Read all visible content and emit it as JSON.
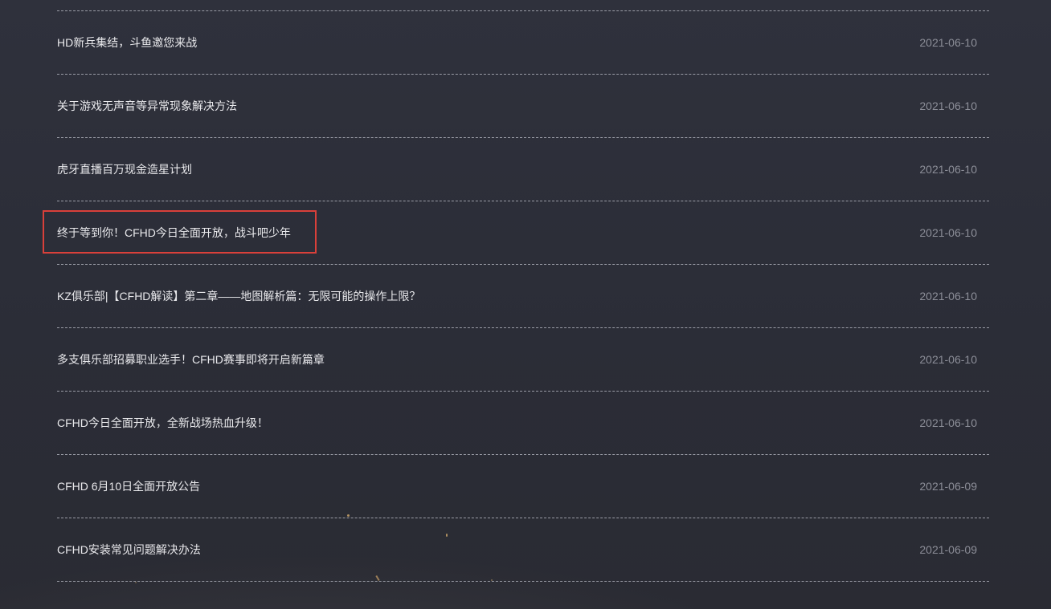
{
  "news": {
    "items": [
      {
        "title": "HD新兵集结，斗鱼邀您来战",
        "date": "2021-06-10"
      },
      {
        "title": "关于游戏无声音等异常现象解决方法",
        "date": "2021-06-10"
      },
      {
        "title": "虎牙直播百万现金造星计划",
        "date": "2021-06-10"
      },
      {
        "title": "终于等到你！CFHD今日全面开放，战斗吧少年",
        "date": "2021-06-10"
      },
      {
        "title": "KZ俱乐部|【CFHD解读】第二章——地图解析篇：无限可能的操作上限？",
        "date": "2021-06-10"
      },
      {
        "title": "多支俱乐部招募职业选手！CFHD赛事即将开启新篇章",
        "date": "2021-06-10"
      },
      {
        "title": "CFHD今日全面开放，全新战场热血升级！",
        "date": "2021-06-10"
      },
      {
        "title": "CFHD 6月10日全面开放公告",
        "date": "2021-06-09"
      },
      {
        "title": "CFHD安装常见问题解决办法",
        "date": "2021-06-09"
      }
    ]
  },
  "colors": {
    "background": "#2c2e38",
    "title_text": "#e9e9ec",
    "date_text": "#8c8e98",
    "divider": "#9a9ca6",
    "highlight": "#d9403a"
  }
}
